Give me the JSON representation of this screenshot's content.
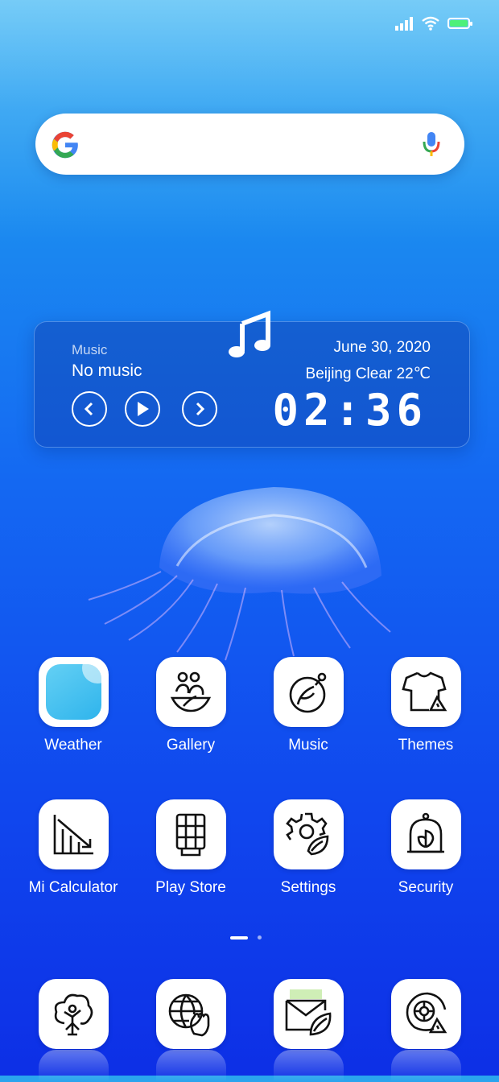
{
  "status_bar": {
    "icons": [
      "signal-icon",
      "wifi-icon",
      "battery-icon"
    ],
    "battery_color": "#4ef07a"
  },
  "search": {
    "placeholder": "",
    "icons": [
      "google-logo-icon",
      "mic-icon"
    ]
  },
  "music_widget": {
    "label": "Music",
    "track": "No music",
    "date": "June  30, 2020",
    "weather": "Beijing  Clear  22℃",
    "time": "02:36",
    "controls": [
      "prev-icon",
      "play-icon",
      "next-icon"
    ]
  },
  "apps": [
    {
      "label": "Weather",
      "icon": "weather-icon"
    },
    {
      "label": "Gallery",
      "icon": "gallery-icon"
    },
    {
      "label": "Music",
      "icon": "music-icon"
    },
    {
      "label": "Themes",
      "icon": "themes-icon"
    },
    {
      "label": "Mi Calculator",
      "icon": "calculator-icon"
    },
    {
      "label": "Play Store",
      "icon": "play-store-icon"
    },
    {
      "label": "Settings",
      "icon": "settings-icon"
    },
    {
      "label": "Security",
      "icon": "security-icon"
    }
  ],
  "dock": [
    {
      "icon": "tree-person-icon"
    },
    {
      "icon": "browser-globe-icon"
    },
    {
      "icon": "mail-leaf-icon"
    },
    {
      "icon": "cleaner-icon"
    }
  ],
  "page_indicator": {
    "count": 2,
    "active": 0
  }
}
